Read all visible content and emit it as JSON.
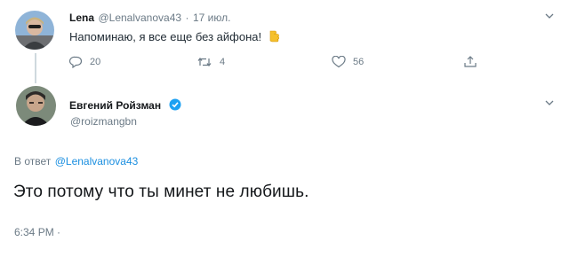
{
  "tweet1": {
    "name": "Lena",
    "handle": "@Lenalvanova43",
    "separator": "·",
    "date": "17 июл.",
    "text": "Напоминаю, я все еще без айфона!",
    "emoji": "hand-pointing-icon",
    "actions": {
      "replies": "20",
      "retweets": "4",
      "likes": "56"
    }
  },
  "tweet2": {
    "name": "Евгений Ройзман",
    "handle": "@roizmangbn",
    "reply_prefix": "В ответ",
    "reply_to": "@Lenalvanova43",
    "text": "Это потому что ты минет не любишь.",
    "time": "6:34 PM ·"
  },
  "colors": {
    "link": "#1b8fe0",
    "muted": "#6b7a86",
    "verified": "#1da1f2"
  }
}
